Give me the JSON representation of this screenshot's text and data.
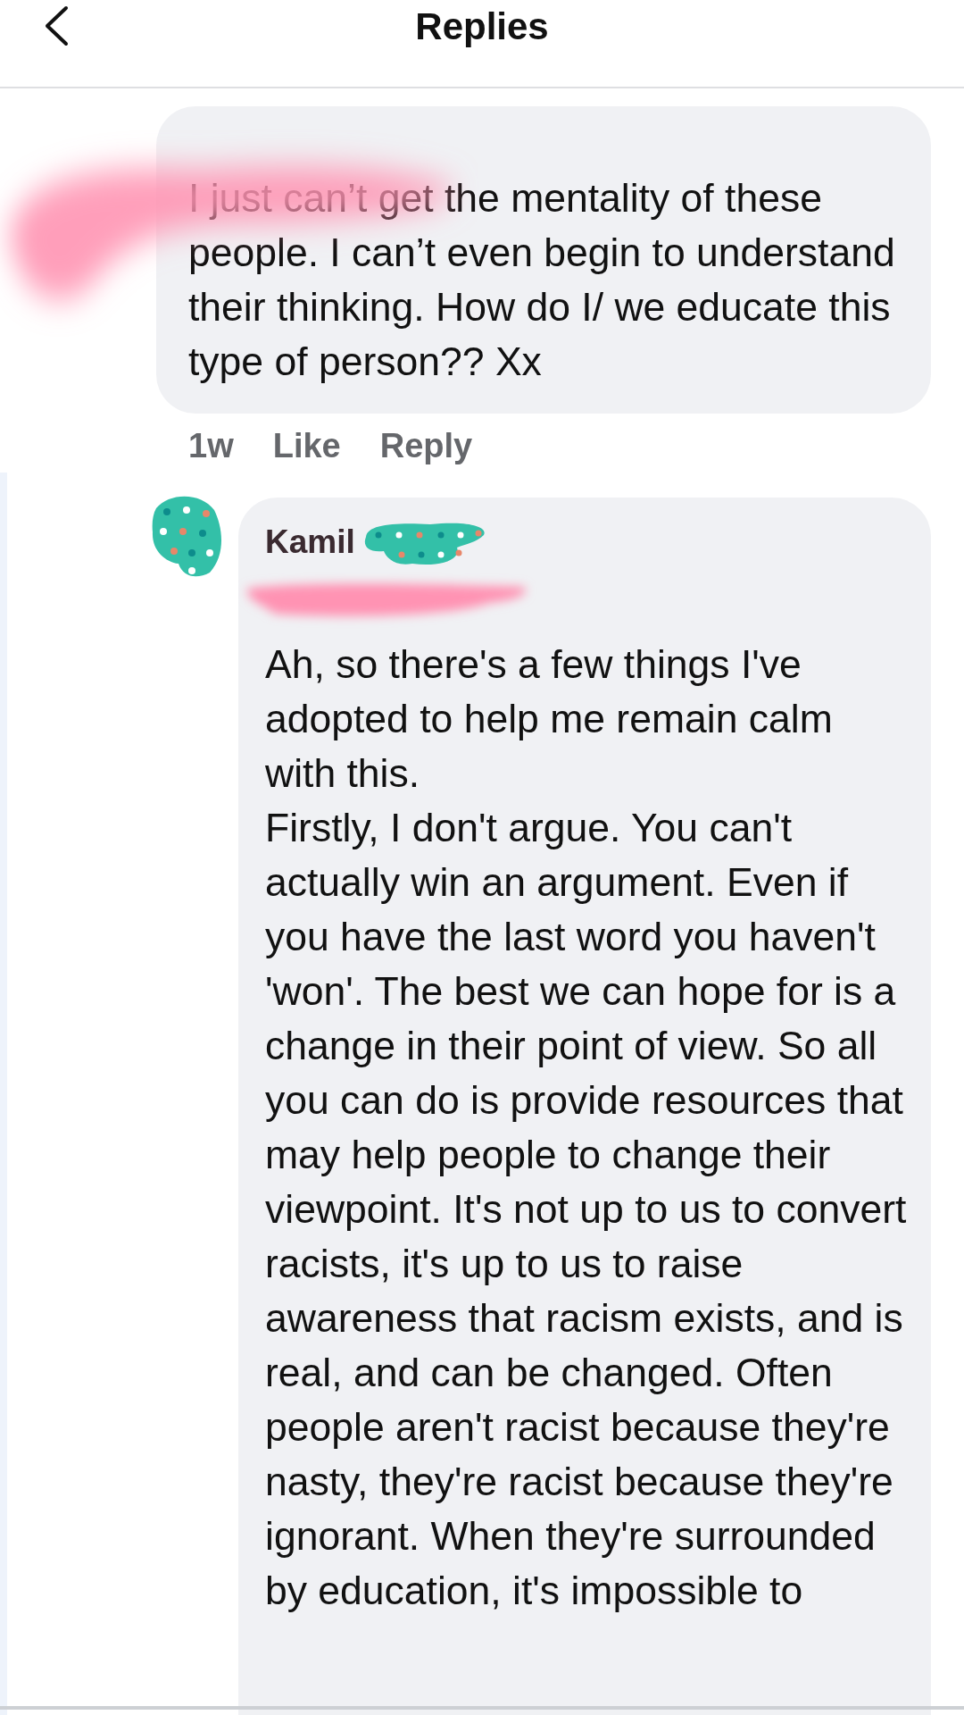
{
  "header": {
    "title": "Replies"
  },
  "comments": [
    {
      "paragraphs": [
        "I just can’t get the mentality of these people. I can’t even begin to understand their thinking. How do I/ we educate this type of person?? Xx"
      ],
      "time": "1w",
      "actions": [
        "Like",
        "Reply"
      ]
    },
    {
      "author": "Kamil",
      "paragraphs": [
        "Ah, so there's a few things I've adopted to help me remain calm with this.",
        "Firstly, I don't argue. You can't actually win an argument. Even if you have the last word you haven't 'won'. The best we can hope for is a change in their point of view. So all you can do is provide resources that may help people to change their viewpoint. It's not up to us to convert racists, it's up to us to raise awareness that racism exists, and is real, and can be changed. Often people aren't racist because they're nasty, they're racist because they're ignorant. When they're surrounded by education, it's impossible to"
      ]
    }
  ]
}
